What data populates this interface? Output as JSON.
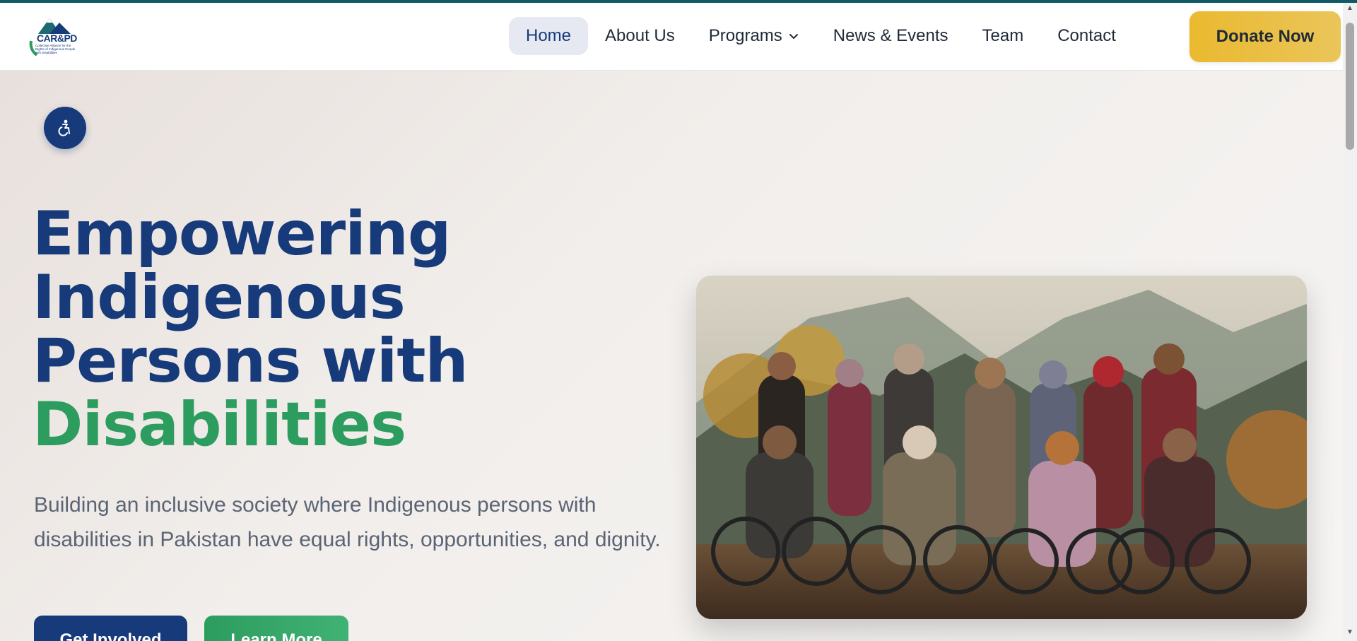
{
  "colors": {
    "brand_blue": "#163a7a",
    "brand_green": "#2d9d5f",
    "accent_gold": "#eab92f",
    "top_line": "#0f5a63"
  },
  "logo": {
    "name": "CAR&PD",
    "tagline": "Collective Alliance for the Rights of Indigenous People with Disabilities"
  },
  "nav": {
    "items": [
      {
        "label": "Home",
        "active": true
      },
      {
        "label": "About Us"
      },
      {
        "label": "Programs",
        "icon": "chevron-down-icon"
      },
      {
        "label": "News & Events"
      },
      {
        "label": "Team"
      },
      {
        "label": "Contact"
      }
    ],
    "cta_label": "Donate Now"
  },
  "hero": {
    "accessibility_icon": "accessibility-icon",
    "headline": {
      "line1": "Empowering",
      "line2": "Indigenous",
      "line3": "Persons with",
      "line4": "Disabilities"
    },
    "subtext": "Building an inclusive society where Indigenous persons with disabilities in Pakistan have equal rights, opportunities, and dignity.",
    "primary_button": "Get Involved",
    "secondary_button": "Learn More",
    "image_subject": "group-photo"
  }
}
